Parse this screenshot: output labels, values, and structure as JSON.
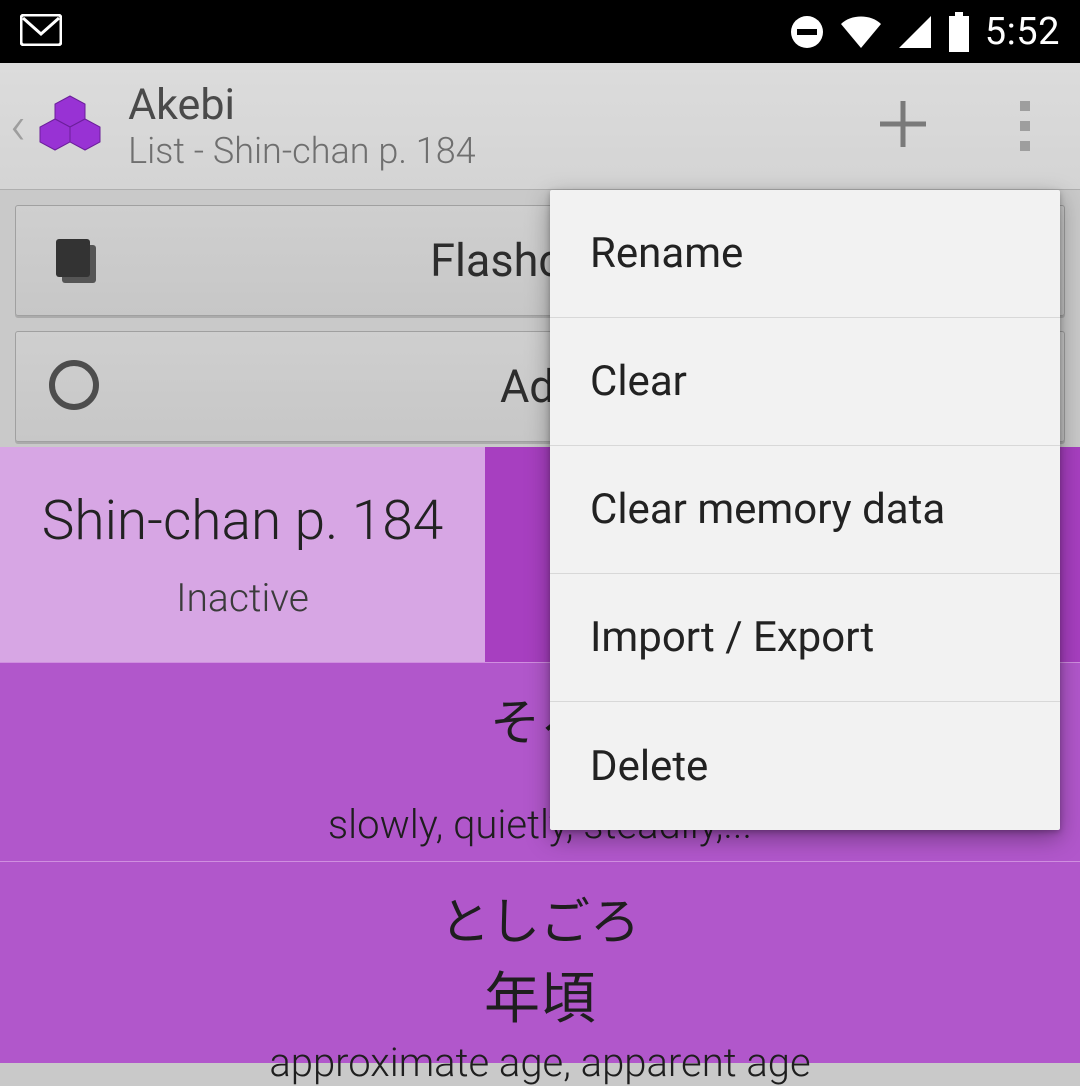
{
  "status": {
    "time": "5:52",
    "icons": [
      "dnd-icon",
      "wifi-icon",
      "cell-icon",
      "battery-icon"
    ]
  },
  "appbar": {
    "title": "Akebi",
    "subtitle": "List - Shin-chan p. 184"
  },
  "buttons": {
    "flashcards": "Flashcards",
    "add": "Add"
  },
  "list": {
    "name": "Shin-chan p. 184",
    "status": "Inactive"
  },
  "vocab": [
    {
      "reading": "そろ",
      "kanji": "",
      "meaning": "slowly, quietly, steadily,..."
    },
    {
      "reading": "としごろ",
      "kanji": "年頃",
      "meaning": "approximate age, apparent age"
    }
  ],
  "menu": {
    "items": [
      "Rename",
      "Clear",
      "Clear memory data",
      "Import / Export",
      "Delete"
    ]
  }
}
